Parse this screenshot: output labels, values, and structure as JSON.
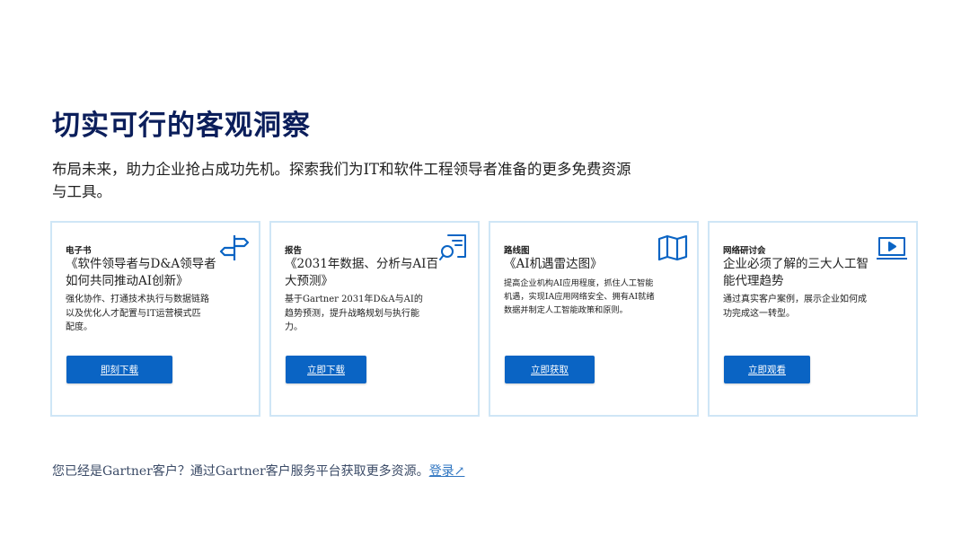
{
  "header": {
    "title": "切实可行的客观洞察",
    "subtitle": "布局未来，助力企业抢占成功先机。探索我们为IT和软件工程领导者准备的更多免费资源与工具。"
  },
  "cards": [
    {
      "kind": "电子书",
      "title": "《软件领导者与D&A领导者如何共同推动AI创新》",
      "description": "强化协作、打通技术执行与数据链路以及优化人才配置与IT运营模式匹配度。",
      "button_label": "即刻下载",
      "icon": "signpost-icon"
    },
    {
      "kind": "报告",
      "title": "《2031年数据、分析与AI百大预测》",
      "description": "基于Gartner 2031年D&A与AI的趋势预测，提升战略规划与执行能力。",
      "button_label": "立即下载",
      "icon": "document-search-icon"
    },
    {
      "kind": "路线图",
      "title": "《AI机遇雷达图》",
      "description": "提高企业机构AI应用程度，抓住人工智能机遇，实现IA应用网络安全、拥有AI就绪数据并制定人工智能政策和原则。",
      "button_label": "立即获取",
      "icon": "map-icon"
    },
    {
      "kind": "网络研讨会",
      "title": "企业必须了解的三大人工智能代理趋势",
      "description": "通过真实客户案例，展示企业如何成功完成这一转型。",
      "button_label": "立即观看",
      "icon": "video-play-icon"
    }
  ],
  "footer": {
    "text": "您已经是Gartner客户？通过Gartner客户服务平台获取更多资源。",
    "link_label": "登录↗"
  },
  "colors": {
    "title": "#0b1e5b",
    "button": "#0a64c4",
    "card_border": "#cfe6f6",
    "icon": "#0a64c4",
    "link": "#2e74c0"
  }
}
